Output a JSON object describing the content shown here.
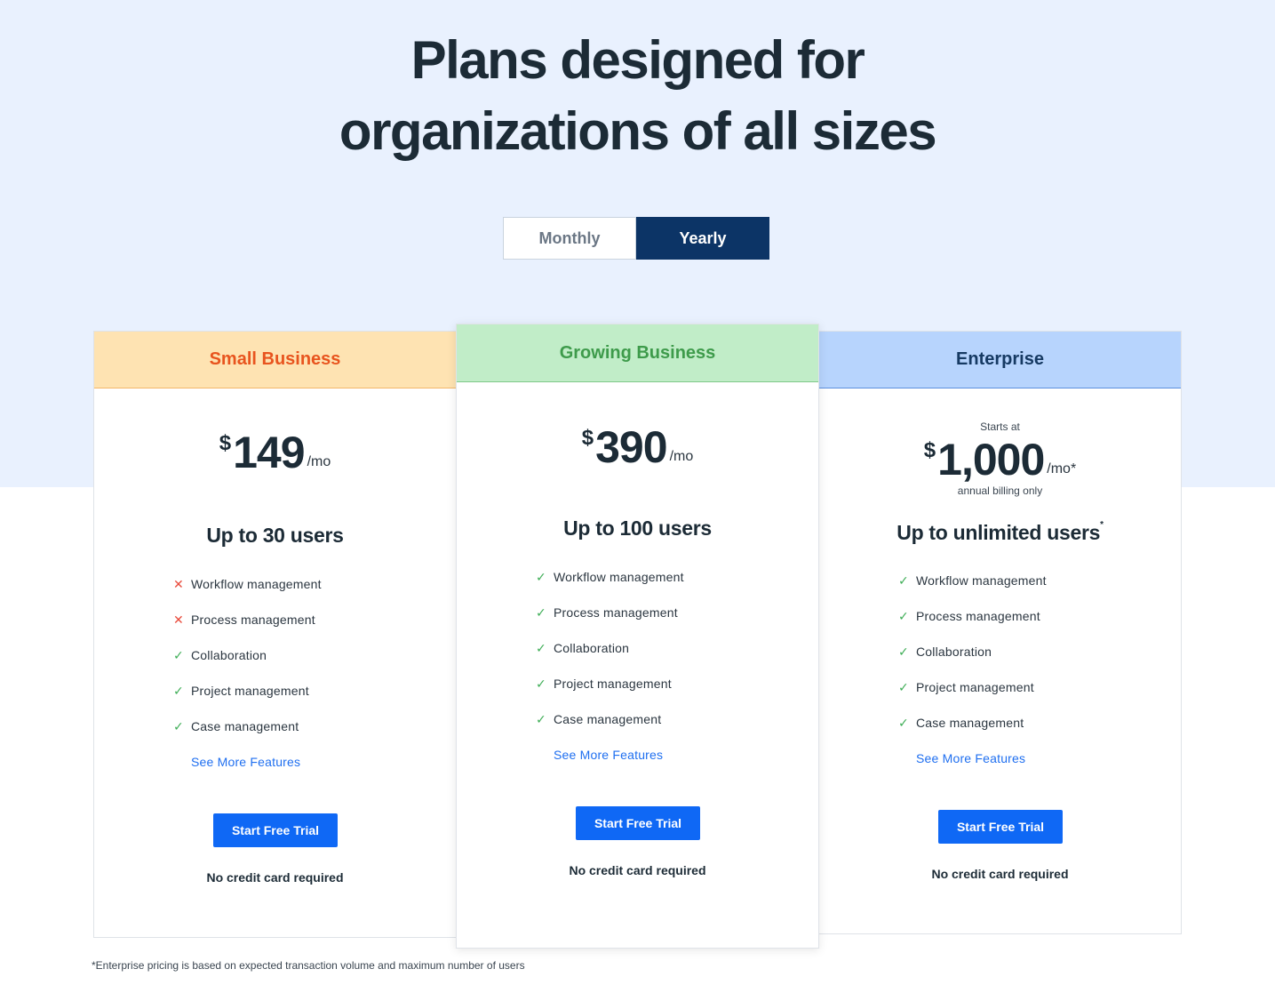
{
  "headline": {
    "line1": "Plans designed for",
    "line2": "organizations of all sizes"
  },
  "billing_toggle": {
    "monthly_label": "Monthly",
    "yearly_label": "Yearly",
    "selected": "Yearly"
  },
  "plans": [
    {
      "name": "Small Business",
      "currency": "$",
      "price": "149",
      "period": "/mo",
      "users": "Up to 30 users",
      "features": [
        {
          "label": "Workflow management",
          "included": false,
          "icon": "cross-icon"
        },
        {
          "label": "Process management",
          "included": false,
          "icon": "cross-icon"
        },
        {
          "label": "Collaboration",
          "included": true,
          "icon": "check-icon"
        },
        {
          "label": "Project management",
          "included": true,
          "icon": "check-icon"
        },
        {
          "label": "Case management",
          "included": true,
          "icon": "check-icon"
        }
      ],
      "see_more": "See More Features",
      "cta": "Start Free Trial",
      "note": "No credit card required"
    },
    {
      "name": "Growing Business",
      "currency": "$",
      "price": "390",
      "period": "/mo",
      "users": "Up to 100 users",
      "features": [
        {
          "label": "Workflow management",
          "included": true,
          "icon": "check-icon"
        },
        {
          "label": "Process management",
          "included": true,
          "icon": "check-icon"
        },
        {
          "label": "Collaboration",
          "included": true,
          "icon": "check-icon"
        },
        {
          "label": "Project management",
          "included": true,
          "icon": "check-icon"
        },
        {
          "label": "Case management",
          "included": true,
          "icon": "check-icon"
        }
      ],
      "see_more": "See More Features",
      "cta": "Start Free Trial",
      "note": "No credit card required"
    },
    {
      "name": "Enterprise",
      "starts_at": "Starts at",
      "currency": "$",
      "price": "1,000",
      "period": "/mo*",
      "billing_note": "annual billing only",
      "users": "Up to unlimited users",
      "users_mark": "*",
      "features": [
        {
          "label": "Workflow management",
          "included": true,
          "icon": "check-icon"
        },
        {
          "label": "Process management",
          "included": true,
          "icon": "check-icon"
        },
        {
          "label": "Collaboration",
          "included": true,
          "icon": "check-icon"
        },
        {
          "label": "Project management",
          "included": true,
          "icon": "check-icon"
        },
        {
          "label": "Case management",
          "included": true,
          "icon": "check-icon"
        }
      ],
      "see_more": "See More Features",
      "cta": "Start Free Trial",
      "note": "No credit card required"
    }
  ],
  "footnote": "*Enterprise pricing is based on expected transaction volume and maximum number of users",
  "colors": {
    "band_background": "#e9f1fe",
    "toggle_active": "#0c3466",
    "cta_blue": "#0f68f5",
    "link_blue": "#1f6ff0",
    "check_green": "#3fae57",
    "cross_red": "#e94c3d",
    "small_header_bg": "#fee3b2",
    "small_header_text": "#e8541e",
    "growing_header_bg": "#c1edc8",
    "growing_header_text": "#3e9b4b",
    "enterprise_header_bg": "#b7d4fd",
    "enterprise_header_text": "#163a63"
  }
}
